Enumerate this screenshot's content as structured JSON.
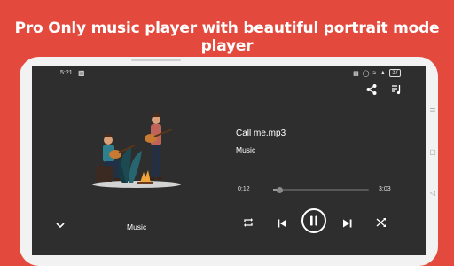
{
  "headline": "Pro Only music player with beautiful portrait mode player",
  "status_bar": {
    "time": "5:21",
    "battery": "37"
  },
  "track": {
    "title": "Call me.mp3",
    "artist": "Music"
  },
  "playback": {
    "elapsed": "0:12",
    "duration": "3:03",
    "progress": 0.065
  },
  "bottom_bar": {
    "label": "Music"
  },
  "icons": [
    "share-icon",
    "queue-icon",
    "chevron-down-icon",
    "repeat-icon",
    "previous-icon",
    "pause-icon",
    "next-icon",
    "shuffle-icon"
  ],
  "colors": {
    "background": "#e34a3d",
    "screen": "#2e2e2e",
    "text": "#ffffff"
  }
}
